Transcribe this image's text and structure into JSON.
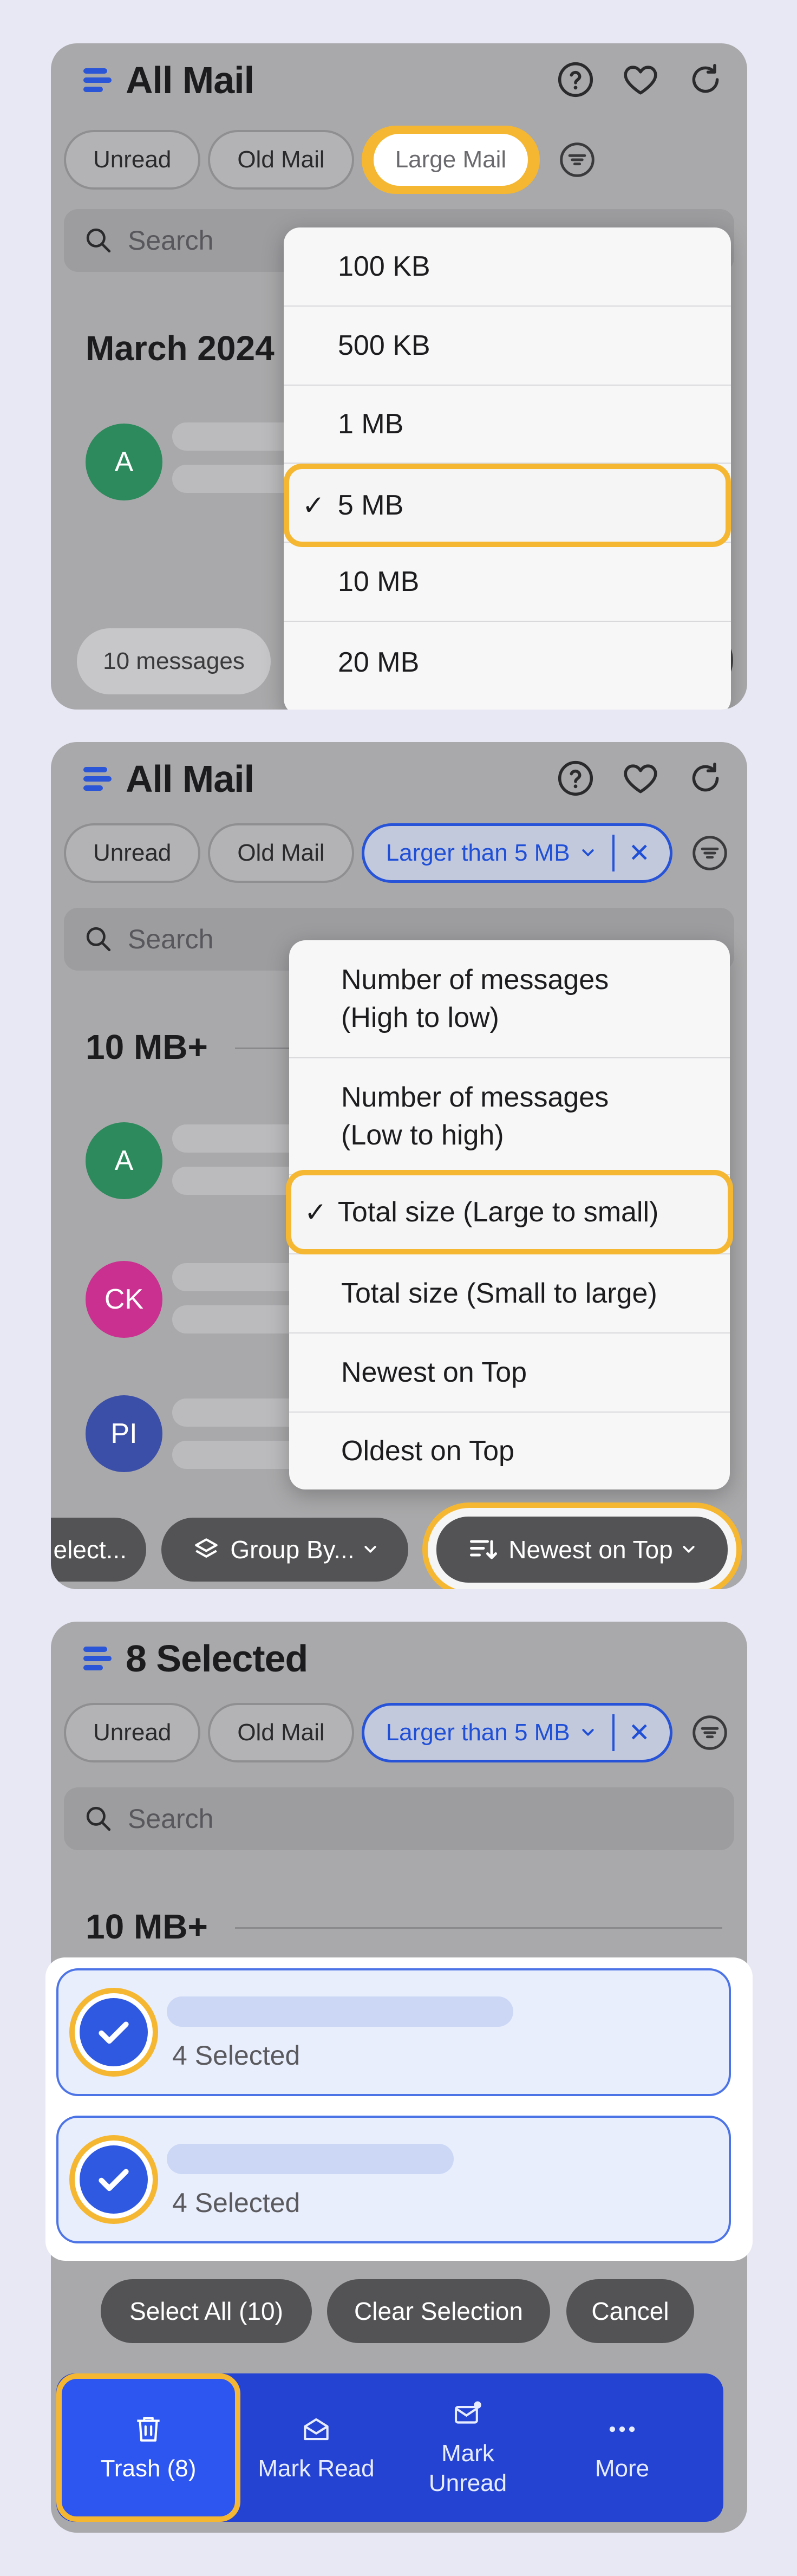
{
  "colors": {
    "accent": "#2653d8",
    "highlight": "#f5b731",
    "toolbar": "#2443d2"
  },
  "panel1": {
    "title": "All Mail",
    "icons": [
      "help-icon",
      "heart-icon",
      "refresh-icon"
    ],
    "chips": [
      "Unread",
      "Old Mail",
      "Large Mail"
    ],
    "search_placeholder": "Search",
    "section": "March 2024",
    "avatar": "A",
    "dropdown": [
      "100 KB",
      "500 KB",
      "1 MB",
      "5 MB",
      "10 MB",
      "20 MB"
    ],
    "selected": "5 MB",
    "check": "✓",
    "messages": "10 messages"
  },
  "panel2": {
    "title": "All Mail",
    "chips": [
      "Unread",
      "Old Mail"
    ],
    "active_chip": "Larger than 5 MB",
    "search_placeholder": "Search",
    "section": "10 MB+",
    "avatars": [
      "A",
      "CK",
      "PI"
    ],
    "dropdown": [
      "Number of messages\n(High to low)",
      "Number of messages\n(Low to high)",
      "Total size (Large to small)",
      "Total size (Small to large)",
      "Newest on Top",
      "Oldest on Top"
    ],
    "selected": "Total size (Large to small)",
    "check": "✓",
    "bottom": {
      "select": "elect...",
      "group": "Group By...",
      "sort": "Newest on Top"
    }
  },
  "panel3": {
    "title": "8 Selected",
    "chips": [
      "Unread",
      "Old Mail"
    ],
    "active_chip": "Larger than 5 MB",
    "search_placeholder": "Search",
    "section": "10 MB+",
    "cards": [
      {
        "label": "4 Selected"
      },
      {
        "label": "4 Selected"
      }
    ],
    "pills": [
      "Select All (10)",
      "Clear Selection",
      "Cancel"
    ],
    "toolbar": [
      {
        "label": "Trash (8)",
        "icon": "trash-icon"
      },
      {
        "label": "Mark Read",
        "icon": "mark-read-icon"
      },
      {
        "label": "Mark\nUnread",
        "icon": "mark-unread-icon"
      },
      {
        "label": "More",
        "icon": "more-icon"
      }
    ]
  }
}
